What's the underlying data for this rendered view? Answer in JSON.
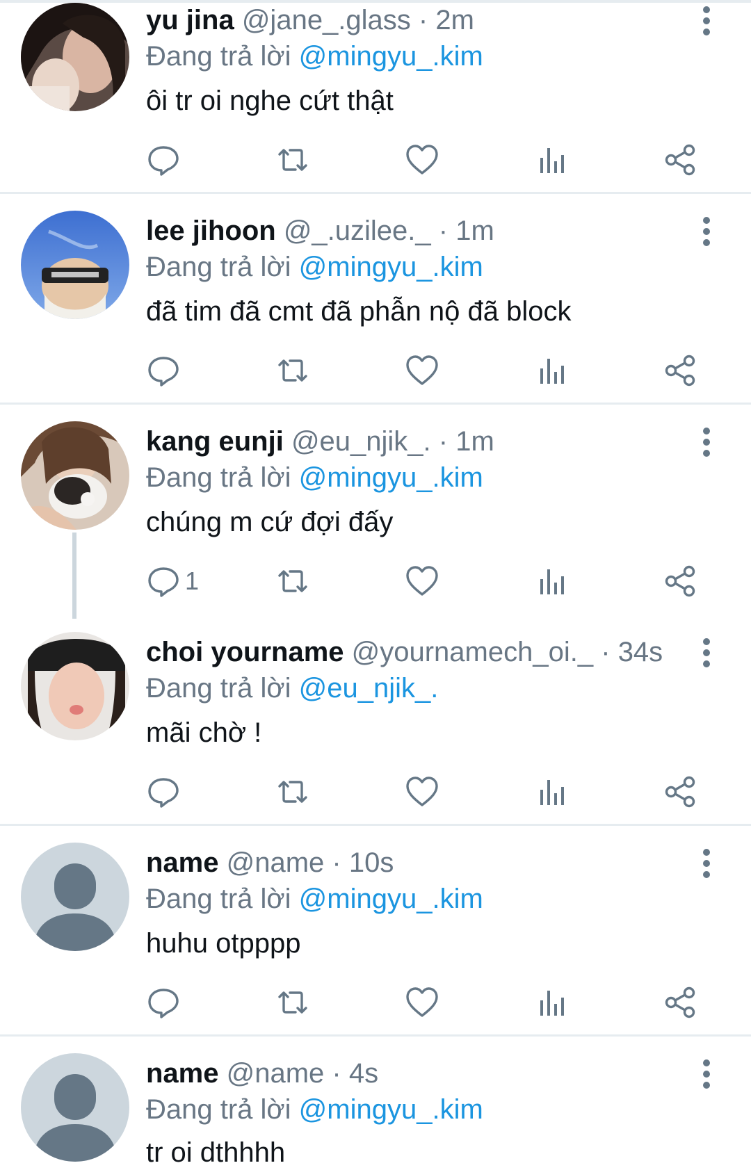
{
  "tweets": [
    {
      "name": "yu jina",
      "handle": "@jane_.glass",
      "time": "2m",
      "reply_prefix": "Đang trả lời",
      "reply_to": "@mingyu_.kim",
      "text": "ôi tr oi nghe cứt thật",
      "reply_count": "",
      "avatar": "photo-dark-hair"
    },
    {
      "name": "lee jihoon",
      "handle": "@_.uzilee._",
      "time": "1m",
      "reply_prefix": "Đang trả lời",
      "reply_to": "@mingyu_.kim",
      "text": "đã tim đã cmt đã phẫn nộ đã block",
      "reply_count": "",
      "avatar": "photo-blue-sky"
    },
    {
      "name": "kang eunji",
      "handle": "@eu_njik_.",
      "time": "1m",
      "reply_prefix": "Đang trả lời",
      "reply_to": "@mingyu_.kim",
      "text": "chúng m cứ đợi đấy",
      "reply_count": "1",
      "avatar": "photo-with-cat"
    },
    {
      "name": "choi yourname",
      "handle": "@yournamech_oi._",
      "time": "34s",
      "reply_prefix": "Đang trả lời",
      "reply_to": "@eu_njik_.",
      "text": "mãi chờ !",
      "reply_count": "",
      "avatar": "photo-cap"
    },
    {
      "name": "name",
      "handle": "@name",
      "time": "10s",
      "reply_prefix": "Đang trả lời",
      "reply_to": "@mingyu_.kim",
      "text": "huhu otpppp",
      "reply_count": "",
      "avatar": "default-avatar"
    },
    {
      "name": "name",
      "handle": "@name",
      "time": "4s",
      "reply_prefix": "Đang trả lời",
      "reply_to": "@mingyu_.kim",
      "text": "tr oi dthhhh",
      "reply_count": "",
      "avatar": "default-avatar"
    }
  ],
  "icons": {
    "reply": "reply-icon",
    "retweet": "retweet-icon",
    "like": "heart-icon",
    "analytics": "analytics-icon",
    "share": "share-icon",
    "more": "more-vertical-icon"
  },
  "colors": {
    "mention": "#1b95e0",
    "secondary_text": "#687684",
    "icon": "#657786",
    "divider": "#e6ecf0",
    "thread_line": "#ccd6dd"
  }
}
